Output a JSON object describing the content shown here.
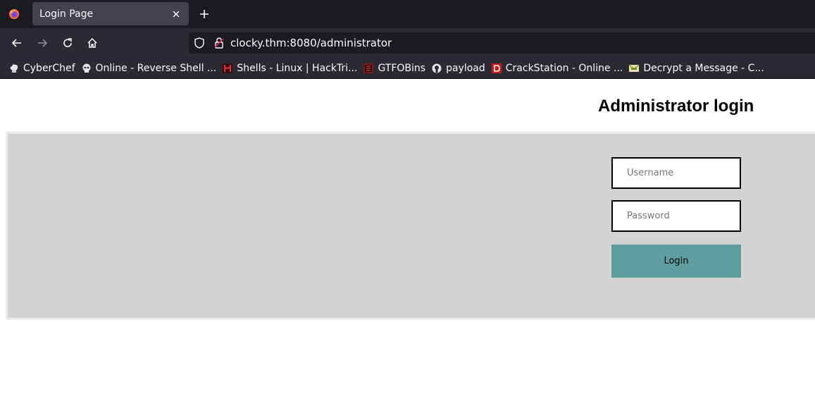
{
  "browser": {
    "tab": {
      "title": "Login Page"
    },
    "url": "clocky.thm:8080/administrator",
    "bookmarks": [
      {
        "label": "CyberChef",
        "icon": "chef-hat-icon"
      },
      {
        "label": "Online - Reverse Shell ...",
        "icon": "skull-icon"
      },
      {
        "label": "Shells - Linux | HackTri...",
        "icon": "hacktricks-icon"
      },
      {
        "label": "GTFOBins",
        "icon": "gtfobins-icon"
      },
      {
        "label": "payload",
        "icon": "github-icon"
      },
      {
        "label": "CrackStation - Online ...",
        "icon": "crackstation-icon"
      },
      {
        "label": "Decrypt a Message - C...",
        "icon": "envelope-icon"
      }
    ]
  },
  "page": {
    "title": "Administrator login",
    "username_placeholder": "Username",
    "password_placeholder": "Password",
    "login_label": "Login"
  },
  "colors": {
    "panel_bg": "#d3d3d3",
    "button_bg": "#5f9ea0"
  }
}
